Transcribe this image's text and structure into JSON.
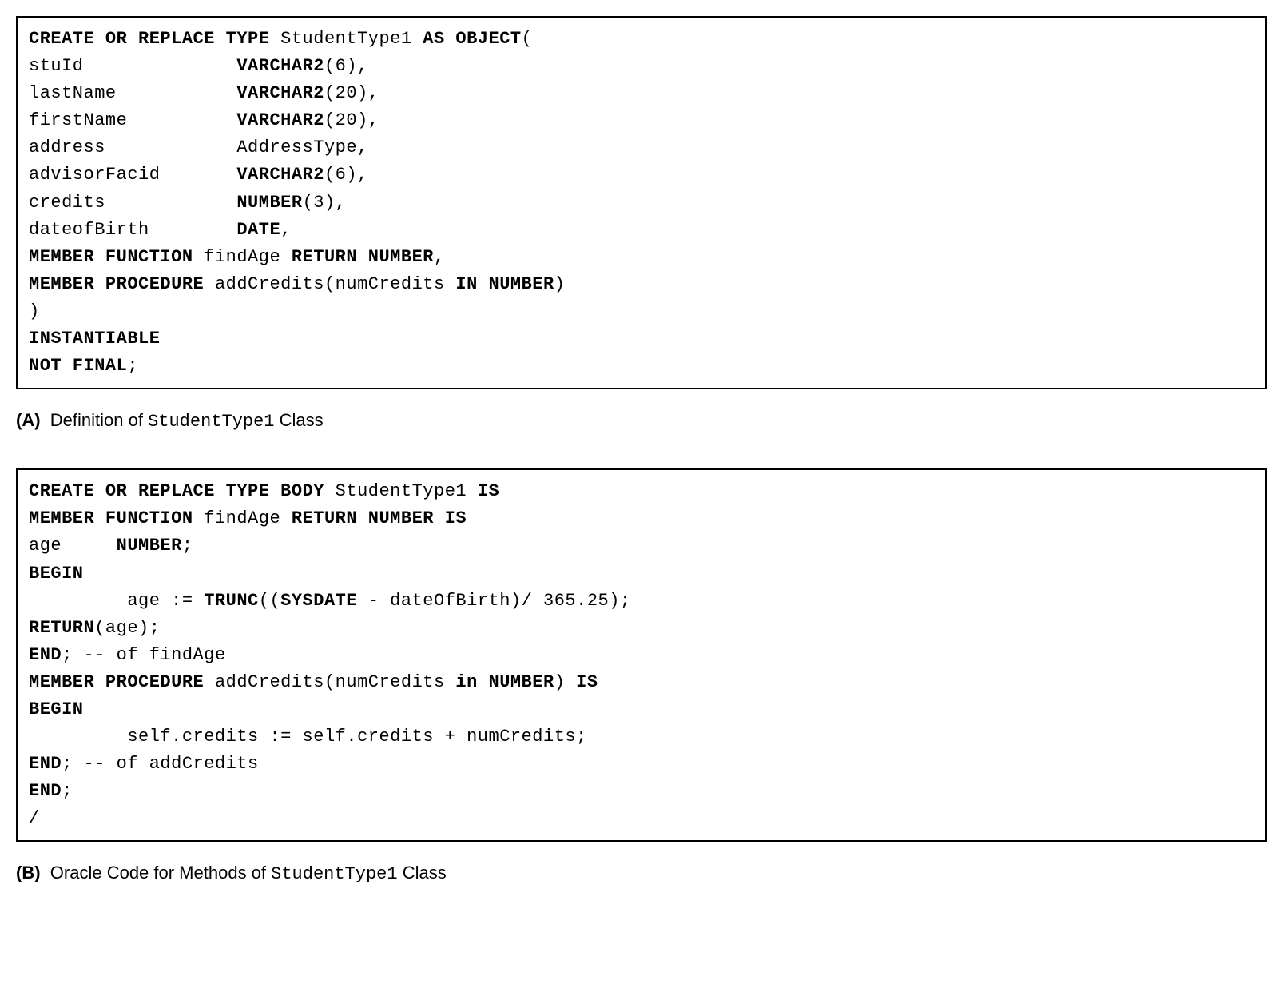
{
  "blockA": {
    "lines": [
      [
        {
          "t": "CREATE OR REPLACE TYPE ",
          "b": true
        },
        {
          "t": "StudentType1",
          "b": false
        },
        {
          "t": " AS OBJECT",
          "b": true
        },
        {
          "t": "(",
          "b": false
        }
      ],
      [
        {
          "t": "stuId              ",
          "b": false
        },
        {
          "t": "VARCHAR2",
          "b": true
        },
        {
          "t": "(6),",
          "b": false
        }
      ],
      [
        {
          "t": "lastName           ",
          "b": false
        },
        {
          "t": "VARCHAR2",
          "b": true
        },
        {
          "t": "(20),",
          "b": false
        }
      ],
      [
        {
          "t": "firstName          ",
          "b": false
        },
        {
          "t": "VARCHAR2",
          "b": true
        },
        {
          "t": "(20),",
          "b": false
        }
      ],
      [
        {
          "t": "address            AddressType,",
          "b": false
        }
      ],
      [
        {
          "t": "advisorFacid       ",
          "b": false
        },
        {
          "t": "VARCHAR2",
          "b": true
        },
        {
          "t": "(6),",
          "b": false
        }
      ],
      [
        {
          "t": "credits            ",
          "b": false
        },
        {
          "t": "NUMBER",
          "b": true
        },
        {
          "t": "(3),",
          "b": false
        }
      ],
      [
        {
          "t": "dateofBirth        ",
          "b": false
        },
        {
          "t": "DATE",
          "b": true
        },
        {
          "t": ",",
          "b": false
        }
      ],
      [
        {
          "t": "MEMBER FUNCTION ",
          "b": true
        },
        {
          "t": "findAge",
          "b": false
        },
        {
          "t": " RETURN NUMBER",
          "b": true
        },
        {
          "t": ",",
          "b": false
        }
      ],
      [
        {
          "t": "MEMBER PROCEDURE ",
          "b": true
        },
        {
          "t": "addCredits(numCredits",
          "b": false
        },
        {
          "t": " IN NUMBER",
          "b": true
        },
        {
          "t": ")",
          "b": false
        }
      ],
      [
        {
          "t": ")",
          "b": false
        }
      ],
      [
        {
          "t": "INSTANTIABLE",
          "b": true
        }
      ],
      [
        {
          "t": "NOT FINAL",
          "b": true
        },
        {
          "t": ";",
          "b": false
        }
      ]
    ]
  },
  "captionA": {
    "letter": "(A)",
    "pre": "Definition of ",
    "mono": "StudentType1",
    "post": " Class"
  },
  "blockB": {
    "lines": [
      [
        {
          "t": "CREATE OR REPLACE TYPE BODY ",
          "b": true
        },
        {
          "t": "StudentType1",
          "b": false
        },
        {
          "t": " IS",
          "b": true
        }
      ],
      [
        {
          "t": "MEMBER FUNCTION ",
          "b": true
        },
        {
          "t": "findAge",
          "b": false
        },
        {
          "t": " RETURN NUMBER IS",
          "b": true
        }
      ],
      [
        {
          "t": "age     ",
          "b": false
        },
        {
          "t": "NUMBER",
          "b": true
        },
        {
          "t": ";",
          "b": false
        }
      ],
      [
        {
          "t": "BEGIN",
          "b": true
        }
      ],
      [
        {
          "t": "         age := ",
          "b": false
        },
        {
          "t": "TRUNC",
          "b": true
        },
        {
          "t": "((",
          "b": false
        },
        {
          "t": "SYSDATE",
          "b": true
        },
        {
          "t": " - dateOfBirth)/ 365.25);",
          "b": false
        }
      ],
      [
        {
          "t": "RETURN",
          "b": true
        },
        {
          "t": "(age);",
          "b": false
        }
      ],
      [
        {
          "t": "END",
          "b": true
        },
        {
          "t": "; -- of findAge",
          "b": false
        }
      ],
      [
        {
          "t": "MEMBER PROCEDURE ",
          "b": true
        },
        {
          "t": "addCredits(numCredits",
          "b": false
        },
        {
          "t": " in NUMBER",
          "b": true
        },
        {
          "t": ")",
          "b": false
        },
        {
          "t": " IS",
          "b": true
        }
      ],
      [
        {
          "t": "BEGIN",
          "b": true
        }
      ],
      [
        {
          "t": "         self.credits := self.credits + numCredits;",
          "b": false
        }
      ],
      [
        {
          "t": "END",
          "b": true
        },
        {
          "t": "; -- of addCredits",
          "b": false
        }
      ],
      [
        {
          "t": "END",
          "b": true
        },
        {
          "t": ";",
          "b": false
        }
      ],
      [
        {
          "t": "/",
          "b": false
        }
      ]
    ]
  },
  "captionB": {
    "letter": "(B)",
    "pre": "Oracle Code for Methods of ",
    "mono": "StudentType1",
    "post": " Class"
  }
}
